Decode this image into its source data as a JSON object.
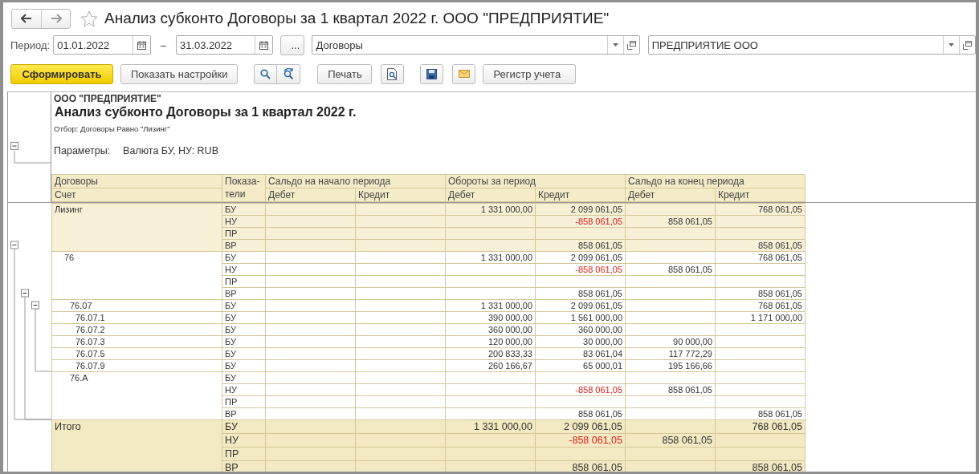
{
  "window": {
    "title": "Анализ субконто Договоры за 1 квартал 2022 г. ООО \"ПРЕДПРИЯТИЕ\"",
    "favorite": false
  },
  "period": {
    "label": "Период:",
    "from": "01.01.2022",
    "separator": "–",
    "to": "31.03.2022",
    "more_button": "..."
  },
  "selectors": [
    {
      "value": "Договоры"
    },
    {
      "value": "ПРЕДПРИЯТИЕ ООО"
    }
  ],
  "toolbar": {
    "generate_button": "Сформировать",
    "settings_button": "Показать настройки",
    "print_button": "Печать",
    "register_menu": "Регистр учета"
  },
  "report": {
    "organization": "ООО \"ПРЕДПРИЯТИЕ\"",
    "title": "Анализ субконто Договоры за 1 квартал 2022 г.",
    "filter": "Отбор: Договоры Равно \"Лизинг\"",
    "parameters_label": "Параметры:",
    "parameters_value": "Валюта БУ, НУ: RUB",
    "header": {
      "col1_top": "Договоры",
      "col1_bottom": "Счет",
      "indicator": "Показа-\nтели",
      "groups": [
        "Сальдо на начало периода",
        "Обороты за период",
        "Сальдо на конец периода"
      ],
      "subcolumns": [
        "Дебет",
        "Кредит",
        "Дебет",
        "Кредит",
        "Дебет",
        "Кредит"
      ]
    },
    "rows": [
      {
        "label": "Лизинг",
        "kind": "contract",
        "lines": [
          {
            "ind": "БУ",
            "turnover_debit": "1 331 000,00",
            "turnover_credit": "2 099 061,05",
            "closing_credit": "768 061,05"
          },
          {
            "ind": "НУ",
            "turnover_credit": "-858 061,05",
            "closing_debit": "858 061,05",
            "turnover_credit_negative": true
          },
          {
            "ind": "ПР"
          },
          {
            "ind": "ВР",
            "turnover_credit": "858 061,05",
            "closing_credit": "858 061,05"
          }
        ],
        "children": [
          {
            "label": "76",
            "kind": "account",
            "lines": [
              {
                "ind": "БУ",
                "turnover_debit": "1 331 000,00",
                "turnover_credit": "2 099 061,05",
                "closing_credit": "768 061,05"
              },
              {
                "ind": "НУ",
                "turnover_credit": "-858 061,05",
                "closing_debit": "858 061,05",
                "turnover_credit_negative": true
              },
              {
                "ind": "ПР"
              },
              {
                "ind": "ВР",
                "turnover_credit": "858 061,05",
                "closing_credit": "858 061,05"
              }
            ],
            "children": [
              {
                "label": "76.07",
                "kind": "account",
                "lines": [
                  {
                    "ind": "БУ",
                    "turnover_debit": "1 331 000,00",
                    "turnover_credit": "2 099 061,05",
                    "closing_credit": "768 061,05"
                  }
                ],
                "children": [
                  {
                    "label": "76.07.1",
                    "kind": "account",
                    "lines": [
                      {
                        "ind": "БУ",
                        "turnover_debit": "390 000,00",
                        "turnover_credit": "1 561 000,00",
                        "closing_credit": "1 171 000,00"
                      }
                    ]
                  },
                  {
                    "label": "76.07.2",
                    "kind": "account",
                    "lines": [
                      {
                        "ind": "БУ",
                        "turnover_debit": "360 000,00",
                        "turnover_credit": "360 000,00"
                      }
                    ]
                  },
                  {
                    "label": "76.07.3",
                    "kind": "account",
                    "lines": [
                      {
                        "ind": "БУ",
                        "turnover_debit": "120 000,00",
                        "turnover_credit": "30 000,00",
                        "closing_debit": "90 000,00"
                      }
                    ]
                  },
                  {
                    "label": "76.07.5",
                    "kind": "account",
                    "lines": [
                      {
                        "ind": "БУ",
                        "turnover_debit": "200 833,33",
                        "turnover_credit": "83 061,04",
                        "closing_debit": "117 772,29"
                      }
                    ]
                  },
                  {
                    "label": "76.07.9",
                    "kind": "account",
                    "lines": [
                      {
                        "ind": "БУ",
                        "turnover_debit": "260 166,67",
                        "turnover_credit": "65 000,01",
                        "closing_debit": "195 166,66"
                      }
                    ]
                  }
                ]
              },
              {
                "label": "76.А",
                "kind": "account",
                "lines": [
                  {
                    "ind": "БУ"
                  },
                  {
                    "ind": "НУ",
                    "turnover_credit": "-858 061,05",
                    "closing_debit": "858 061,05",
                    "turnover_credit_negative": true
                  },
                  {
                    "ind": "ПР"
                  },
                  {
                    "ind": "ВР",
                    "turnover_credit": "858 061,05",
                    "closing_credit": "858 061,05"
                  }
                ]
              }
            ]
          }
        ]
      },
      {
        "label": "Итого",
        "kind": "total",
        "lines": [
          {
            "ind": "БУ",
            "turnover_debit": "1 331 000,00",
            "turnover_credit": "2 099 061,05",
            "closing_credit": "768 061,05"
          },
          {
            "ind": "НУ",
            "turnover_credit": "-858 061,05",
            "closing_debit": "858 061,05",
            "turnover_credit_negative": true
          },
          {
            "ind": "ПР"
          },
          {
            "ind": "ВР",
            "turnover_credit": "858 061,05",
            "closing_credit": "858 061,05"
          }
        ]
      }
    ]
  }
}
